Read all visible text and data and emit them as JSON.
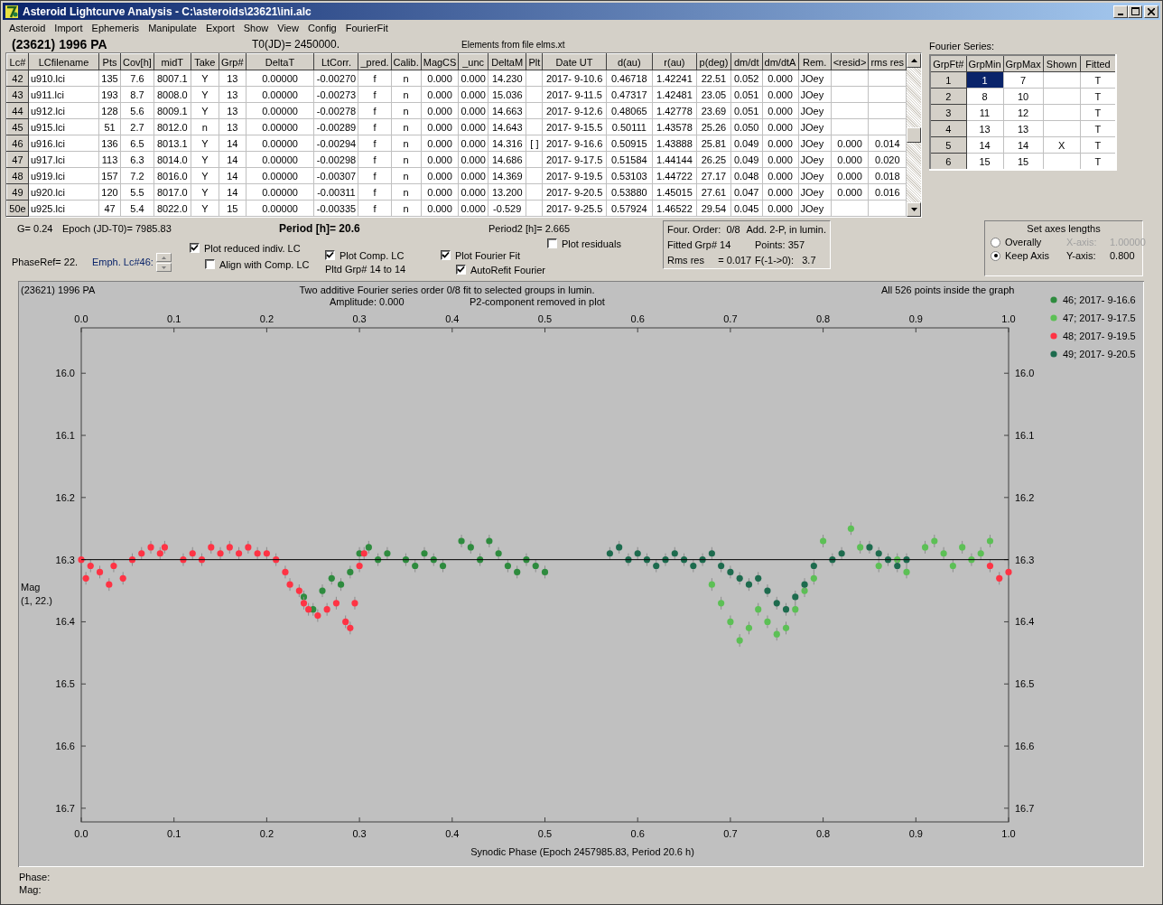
{
  "window": {
    "title": "Asteroid Lightcurve Analysis - C:\\asteroids\\23621\\ini.alc"
  },
  "menu": [
    "Asteroid",
    "Import",
    "Ephemeris",
    "Manipulate",
    "Export",
    "Show",
    "View",
    "Config",
    "FourierFit"
  ],
  "header": {
    "asteroid": "(23621) 1996 PA",
    "t0": "T0(JD)= 2450000.",
    "elements": "Elements from file elms.xt"
  },
  "lc_table": {
    "columns": [
      "Lc#",
      "LCfilename",
      "Pts",
      "Cov[h]",
      "midT",
      "Take",
      "Grp#",
      "DeltaT",
      "LtCorr.",
      "_pred.",
      "Calib.",
      "MagCS",
      "_unc",
      "DeltaM",
      "Plt",
      "Date UT",
      "d(au)",
      "r(au)",
      "p(deg)",
      "dm/dt",
      "dm/dtA",
      "Rem.",
      "<resid>",
      "rms res"
    ],
    "rows": [
      {
        "cells": [
          "42",
          "u910.lci",
          "135",
          "7.6",
          "8007.1",
          "Y",
          "13",
          "0.00000",
          "-0.00270",
          "f",
          "n",
          "0.000",
          "0.000",
          "14.230",
          null,
          "2017- 9-10.6",
          "0.46718",
          "1.42241",
          "22.51",
          "0.052",
          "0.000",
          "JOey",
          null,
          null
        ]
      },
      {
        "cells": [
          "43",
          "u911.lci",
          "193",
          "8.7",
          "8008.0",
          "Y",
          "13",
          "0.00000",
          "-0.00273",
          "f",
          "n",
          "0.000",
          "0.000",
          "15.036",
          null,
          "2017- 9-11.5",
          "0.47317",
          "1.42481",
          "23.05",
          "0.051",
          "0.000",
          "JOey",
          null,
          null
        ]
      },
      {
        "cells": [
          "44",
          "u912.lci",
          "128",
          "5.6",
          "8009.1",
          "Y",
          "13",
          "0.00000",
          "-0.00278",
          "f",
          "n",
          "0.000",
          "0.000",
          "14.663",
          null,
          "2017- 9-12.6",
          "0.48065",
          "1.42778",
          "23.69",
          "0.051",
          "0.000",
          "JOey",
          null,
          null
        ]
      },
      {
        "cells": [
          "45",
          "u915.lci",
          "51",
          "2.7",
          "8012.0",
          "n",
          "13",
          "0.00000",
          "-0.00289",
          "f",
          "n",
          "0.000",
          "0.000",
          "14.643",
          null,
          "2017- 9-15.5",
          "0.50111",
          "1.43578",
          "25.26",
          "0.050",
          "0.000",
          "JOey",
          null,
          null
        ]
      },
      {
        "cells": [
          "46",
          "u916.lci",
          "136",
          "6.5",
          "8013.1",
          "Y",
          "14",
          "0.00000",
          "-0.00294",
          "f",
          "n",
          "0.000",
          "0.000",
          "14.316",
          "[ ]",
          "2017- 9-16.6",
          "0.50915",
          "1.43888",
          "25.81",
          "0.049",
          "0.000",
          "JOey",
          "0.000",
          "0.014"
        ]
      },
      {
        "cells": [
          "47",
          "u917.lci",
          "113",
          "6.3",
          "8014.0",
          "Y",
          "14",
          "0.00000",
          "-0.00298",
          "f",
          "n",
          "0.000",
          "0.000",
          "14.686",
          null,
          "2017- 9-17.5",
          "0.51584",
          "1.44144",
          "26.25",
          "0.049",
          "0.000",
          "JOey",
          "0.000",
          "0.020"
        ]
      },
      {
        "cells": [
          "48",
          "u919.lci",
          "157",
          "7.2",
          "8016.0",
          "Y",
          "14",
          "0.00000",
          "-0.00307",
          "f",
          "n",
          "0.000",
          "0.000",
          "14.369",
          null,
          "2017- 9-19.5",
          "0.53103",
          "1.44722",
          "27.17",
          "0.048",
          "0.000",
          "JOey",
          "0.000",
          "0.018"
        ]
      },
      {
        "cells": [
          "49",
          "u920.lci",
          "120",
          "5.5",
          "8017.0",
          "Y",
          "14",
          "0.00000",
          "-0.00311",
          "f",
          "n",
          "0.000",
          "0.000",
          "13.200",
          null,
          "2017- 9-20.5",
          "0.53880",
          "1.45015",
          "27.61",
          "0.047",
          "0.000",
          "JOey",
          "0.000",
          "0.016"
        ]
      },
      {
        "cells": [
          "50e",
          "u925.lci",
          "47",
          "5.4",
          "8022.0",
          "Y",
          "15",
          "0.00000",
          "-0.00335",
          "f",
          "n",
          "0.000",
          "0.000",
          "-0.529",
          null,
          "2017- 9-25.5",
          "0.57924",
          "1.46522",
          "29.54",
          "0.045",
          "0.000",
          "JOey",
          null,
          null
        ]
      }
    ]
  },
  "fourier_series": {
    "label": "Fourier Series:",
    "columns": [
      "GrpFt#",
      "GrpMin",
      "GrpMax",
      "Shown",
      "Fitted"
    ],
    "rows": [
      {
        "grpft": "1",
        "grp_min": "1",
        "grp_max": "7",
        "fitted": "T",
        "selected": true
      },
      {
        "grpft": "2",
        "grp_min": "8",
        "grp_max": "10",
        "fitted": "T",
        "selected": false
      },
      {
        "grpft": "3",
        "grp_min": "11",
        "grp_max": "12",
        "fitted": "T",
        "selected": false
      },
      {
        "grpft": "4",
        "grp_min": "13",
        "grp_max": "13",
        "fitted": "T",
        "selected": false
      },
      {
        "grpft": "5",
        "grp_min": "14",
        "grp_max": "14",
        "shown": "X",
        "fitted": "T",
        "selected": false
      },
      {
        "grpft": "6",
        "grp_min": "15",
        "grp_max": "15",
        "fitted": "T",
        "selected": false
      }
    ]
  },
  "controls": {
    "g": "G= 0.24",
    "epoch": "Epoch (JD-T0)= 7985.83",
    "period": "Period [h]= 20.6",
    "period2": "Period2 [h]= 2.665",
    "phase_ref": "PhaseRef= 22.",
    "emph": "Emph. Lc#46:",
    "pltd_grp": "Pltd Grp#  14 to   14",
    "checkboxes": [
      {
        "label": "Plot reduced indiv. LC",
        "checked": true
      },
      {
        "label": "Align with Comp. LC",
        "checked": false
      },
      {
        "label": "Plot Comp. LC",
        "checked": true
      },
      {
        "label": "Plot Fourier Fit",
        "checked": true
      },
      {
        "label": "AutoRefit Fourier",
        "checked": true
      },
      {
        "label": "Plot residuals",
        "checked": false
      }
    ]
  },
  "fit_info": [
    [
      "Four. Order:  0/8",
      "Add. 2-P, in lumin."
    ],
    [
      "Fitted Grp# 14",
      "Points: 357"
    ],
    [
      "Rms res     = 0.017",
      "F(-1->0):   3.7"
    ]
  ],
  "axes": {
    "title": "Set axes lengths",
    "options": [
      {
        "label": "Overally",
        "selected": false
      },
      {
        "label": "Keep Axis",
        "selected": true
      }
    ],
    "x_axis": {
      "label": "X-axis:",
      "value": "1.00000",
      "disabled": true
    },
    "y_axis": {
      "label": "Y-axis:",
      "value": "0.800",
      "disabled": false
    }
  },
  "plot": {
    "asteroid": "(23621) 1996 PA",
    "subtitle": "Two additive Fourier series order 0/8 fit to selected groups in lumin.",
    "amplitude": "Amplitude: 0.000",
    "p2_note": "P2-component removed in plot",
    "points_note": "All 526 points inside the graph",
    "y_note": "(1, 22.)",
    "chart_data": {
      "type": "scatter",
      "xlabel": "Synodic Phase (Epoch 2457985.83, Period 20.6 h)",
      "ylabel": "Mag",
      "xlim": [
        0,
        1
      ],
      "ylim": [
        16.722,
        15.927
      ],
      "xticks": [
        {
          "value": 0,
          "label": "0.0"
        },
        {
          "value": 0.1,
          "label": "0.1"
        },
        {
          "value": 0.2,
          "label": "0.2"
        },
        {
          "value": 0.3,
          "label": "0.3"
        },
        {
          "value": 0.4,
          "label": "0.4"
        },
        {
          "value": 0.5,
          "label": "0.5"
        },
        {
          "value": 0.6,
          "label": "0.6"
        },
        {
          "value": 0.7,
          "label": "0.7"
        },
        {
          "value": 0.8,
          "label": "0.8"
        },
        {
          "value": 0.9,
          "label": "0.9"
        },
        {
          "value": 1,
          "label": "1.0"
        }
      ],
      "yticks": [
        {
          "value": 16,
          "label": "16.0"
        },
        {
          "value": 16.1,
          "label": "16.1"
        },
        {
          "value": 16.2,
          "label": "16.2"
        },
        {
          "value": 16.3,
          "label": "16.3"
        },
        {
          "value": 16.4,
          "label": "16.4"
        },
        {
          "value": 16.5,
          "label": "16.5"
        },
        {
          "value": 16.6,
          "label": "16.6"
        },
        {
          "value": 16.7,
          "label": "16.7"
        }
      ],
      "ref_lines": [
        {
          "axis": "y",
          "value": 16.3
        }
      ],
      "legend": true,
      "series": [
        {
          "name": "46; 2017- 9-16.6",
          "color": "#2e8b3e",
          "x": [
            0.24,
            0.25,
            0.26,
            0.27,
            0.28,
            0.29,
            0.3,
            0.31,
            0.32,
            0.33,
            0.35,
            0.36,
            0.37,
            0.38,
            0.39,
            0.41,
            0.42,
            0.43,
            0.44,
            0.45,
            0.46,
            0.47,
            0.48,
            0.49,
            0.5
          ],
          "values": [
            16.36,
            16.38,
            16.35,
            16.33,
            16.34,
            16.32,
            16.29,
            16.28,
            16.3,
            16.29,
            16.3,
            16.31,
            16.29,
            16.3,
            16.31,
            16.27,
            16.28,
            16.3,
            16.27,
            16.29,
            16.31,
            16.32,
            16.3,
            16.31,
            16.32
          ]
        },
        {
          "name": "47; 2017- 9-17.5",
          "color": "#5cc055",
          "x": [
            0.68,
            0.69,
            0.7,
            0.71,
            0.72,
            0.73,
            0.74,
            0.75,
            0.76,
            0.77,
            0.78,
            0.79,
            0.8,
            0.83,
            0.84,
            0.86,
            0.88,
            0.89,
            0.91,
            0.92,
            0.93,
            0.94,
            0.95,
            0.96,
            0.97,
            0.98
          ],
          "values": [
            16.34,
            16.37,
            16.4,
            16.43,
            16.41,
            16.38,
            16.4,
            16.42,
            16.41,
            16.38,
            16.35,
            16.33,
            16.27,
            16.25,
            16.28,
            16.31,
            16.3,
            16.32,
            16.28,
            16.27,
            16.29,
            16.31,
            16.28,
            16.3,
            16.29,
            16.27
          ]
        },
        {
          "name": "48; 2017- 9-19.5",
          "color": "#ff3344",
          "x": [
            0,
            0.005,
            0.01,
            0.02,
            0.03,
            0.035,
            0.045,
            0.055,
            0.065,
            0.075,
            0.085,
            0.09,
            0.11,
            0.12,
            0.13,
            0.14,
            0.15,
            0.16,
            0.17,
            0.18,
            0.19,
            0.2,
            0.21,
            0.22,
            0.225,
            0.235,
            0.24,
            0.245,
            0.255,
            0.265,
            0.275,
            0.285,
            0.29,
            0.295,
            0.3,
            0.305,
            0.98,
            0.99,
            1
          ],
          "values": [
            16.3,
            16.33,
            16.31,
            16.32,
            16.34,
            16.31,
            16.33,
            16.3,
            16.29,
            16.28,
            16.29,
            16.28,
            16.3,
            16.29,
            16.3,
            16.28,
            16.29,
            16.28,
            16.29,
            16.28,
            16.29,
            16.29,
            16.3,
            16.32,
            16.34,
            16.35,
            16.37,
            16.38,
            16.39,
            16.38,
            16.37,
            16.4,
            16.41,
            16.37,
            16.31,
            16.29,
            16.31,
            16.33,
            16.32
          ]
        },
        {
          "name": "49; 2017- 9-20.5",
          "color": "#1d6b4e",
          "x": [
            0.57,
            0.58,
            0.59,
            0.6,
            0.61,
            0.62,
            0.63,
            0.64,
            0.65,
            0.66,
            0.67,
            0.68,
            0.69,
            0.7,
            0.71,
            0.72,
            0.73,
            0.74,
            0.75,
            0.76,
            0.77,
            0.78,
            0.79,
            0.81,
            0.82,
            0.85,
            0.86,
            0.87,
            0.88,
            0.89
          ],
          "values": [
            16.29,
            16.28,
            16.3,
            16.29,
            16.3,
            16.31,
            16.3,
            16.29,
            16.3,
            16.31,
            16.3,
            16.29,
            16.31,
            16.32,
            16.33,
            16.34,
            16.33,
            16.35,
            16.37,
            16.38,
            16.36,
            16.34,
            16.31,
            16.3,
            16.29,
            16.28,
            16.29,
            16.3,
            16.31,
            16.3
          ]
        }
      ]
    }
  },
  "footer": {
    "phase": "Phase:",
    "mag": "Mag:"
  }
}
